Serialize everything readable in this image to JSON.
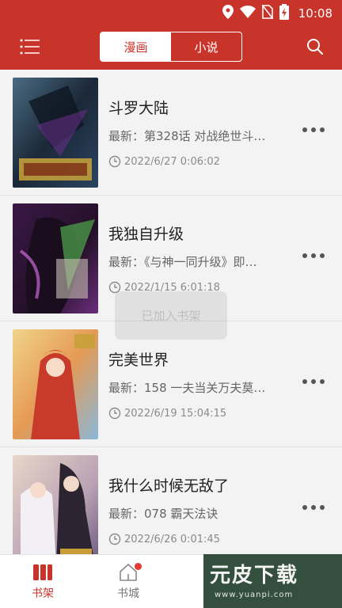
{
  "status_bar": {
    "time": "10:08"
  },
  "app_bar": {
    "tabs": [
      {
        "label": "漫画",
        "active": true
      },
      {
        "label": "小说",
        "active": false
      }
    ]
  },
  "books": [
    {
      "title": "斗罗大陆",
      "latest": "最新：第328话 对战绝世斗…",
      "time": "2022/6/27 0:06:02"
    },
    {
      "title": "我独自升级",
      "latest": "最新：《与神一同升级》即…",
      "time": "2022/1/15 6:01:18"
    },
    {
      "title": "完美世界",
      "latest": "最新：158 一夫当关万夫莫…",
      "time": "2022/6/19 15:04:15"
    },
    {
      "title": "我什么时候无敌了",
      "latest": "最新：078 霸天法诀",
      "time": "2022/6/26 0:01:45"
    }
  ],
  "toast": {
    "text": "已加入书架"
  },
  "bottom_nav": {
    "items": [
      {
        "label": "书架",
        "active": true
      },
      {
        "label": "书城",
        "active": false,
        "badge": true
      }
    ]
  },
  "watermark": {
    "logo": "元皮下载",
    "url": "www.yuanpi.com"
  },
  "colors": {
    "primary": "#c8342a",
    "badge": "#e53935"
  }
}
